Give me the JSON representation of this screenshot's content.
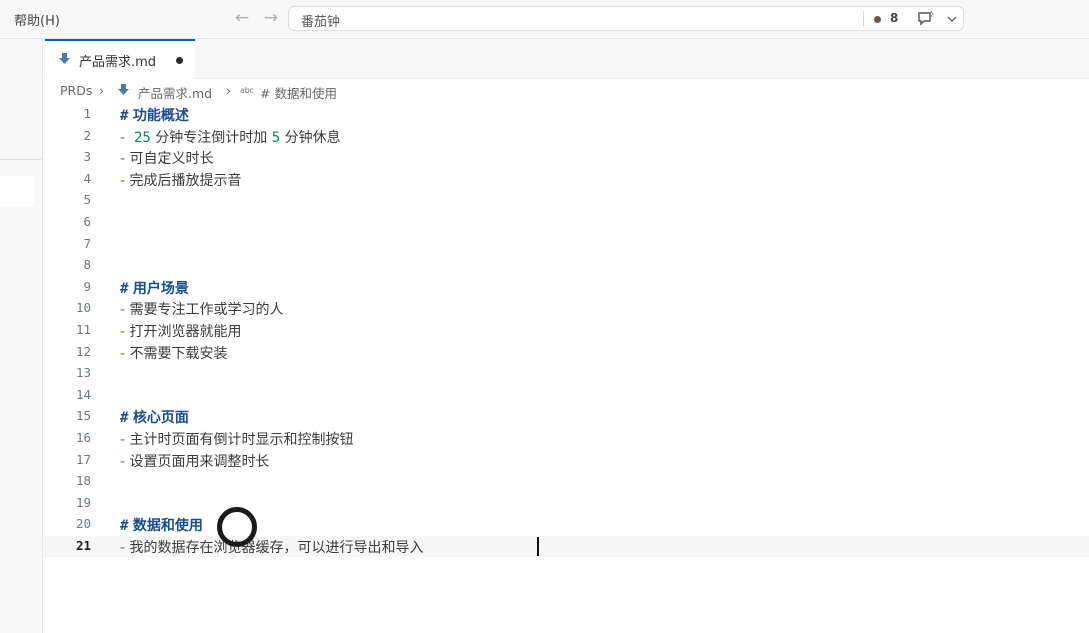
{
  "menu": {
    "help_label": "帮助(H)"
  },
  "command_center": {
    "text": "番茄钟",
    "problem_count": "8"
  },
  "tab": {
    "label": "产品需求.md"
  },
  "breadcrumb": {
    "folder": "PRDs",
    "file": "产品需求.md",
    "symbol_badge": "abc",
    "heading": "# 数据和使用"
  },
  "lines": [
    {
      "n": "1",
      "kind": "heading",
      "mark": "#",
      "text": "功能概述"
    },
    {
      "n": "2",
      "kind": "bullet",
      "dash": "-",
      "text": "",
      "parts": [
        "25",
        " 分钟专注倒计时加 ",
        "5",
        " 分钟休息"
      ]
    },
    {
      "n": "3",
      "kind": "bullet",
      "dash": "-",
      "text": "可自定义时长"
    },
    {
      "n": "4",
      "kind": "bullet",
      "dash": "-",
      "text": "完成后播放提示音"
    },
    {
      "n": "5",
      "kind": "empty"
    },
    {
      "n": "6",
      "kind": "empty"
    },
    {
      "n": "7",
      "kind": "empty"
    },
    {
      "n": "8",
      "kind": "empty"
    },
    {
      "n": "9",
      "kind": "heading",
      "mark": "#",
      "text": "用户场景"
    },
    {
      "n": "10",
      "kind": "bullet",
      "dash": "-",
      "text": "需要专注工作或学习的人"
    },
    {
      "n": "11",
      "kind": "bullet",
      "dash": "-",
      "text": "打开浏览器就能用"
    },
    {
      "n": "12",
      "kind": "bullet",
      "dash": "-",
      "text": "不需要下载安装"
    },
    {
      "n": "13",
      "kind": "empty"
    },
    {
      "n": "14",
      "kind": "empty"
    },
    {
      "n": "15",
      "kind": "heading",
      "mark": "#",
      "text": "核心页面"
    },
    {
      "n": "16",
      "kind": "bullet",
      "dash": "-",
      "text": "主计时页面有倒计时显示和控制按钮"
    },
    {
      "n": "17",
      "kind": "bullet",
      "dash": "-",
      "text": "设置页面用来调整时长"
    },
    {
      "n": "18",
      "kind": "empty"
    },
    {
      "n": "19",
      "kind": "empty"
    },
    {
      "n": "20",
      "kind": "heading",
      "mark": "#",
      "text": "数据和使用"
    },
    {
      "n": "21",
      "kind": "bullet",
      "dash": "-",
      "text": "我的数据存在浏览器缓存，可以进行导出和导入",
      "current": true
    }
  ]
}
